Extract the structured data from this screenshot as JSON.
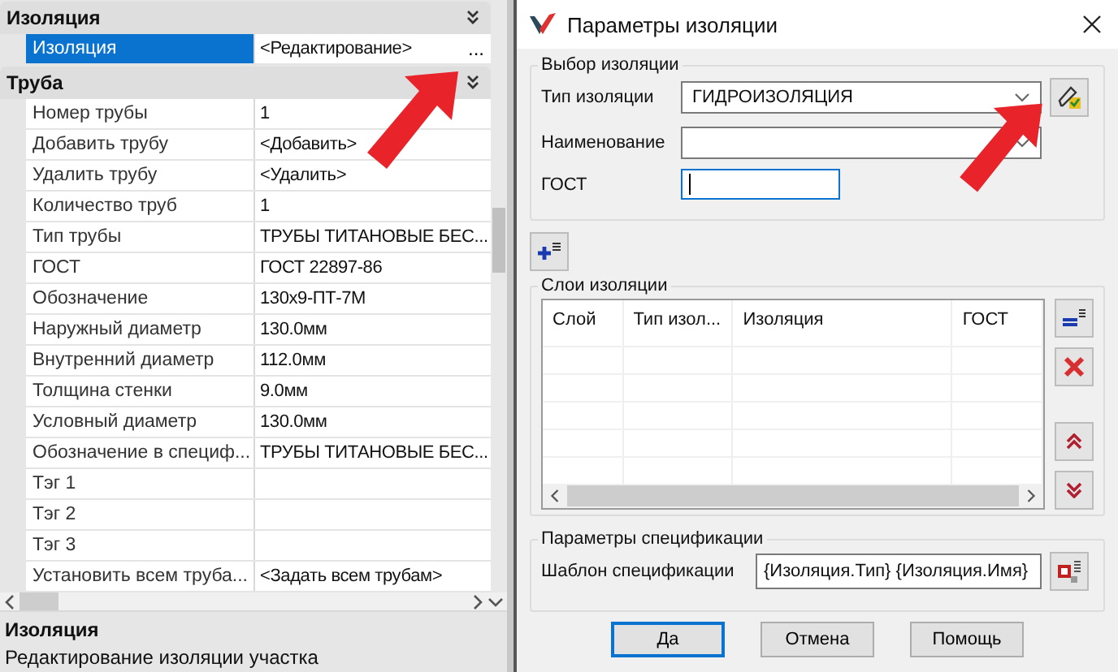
{
  "property_panel": {
    "categories": [
      {
        "title": "Изоляция",
        "expanded": true,
        "rows": [
          {
            "label": "Изоляция",
            "value": "<Редактирование>",
            "button": "...",
            "selected": true
          }
        ]
      },
      {
        "title": "Труба",
        "expanded": true,
        "rows": [
          {
            "label": "Номер трубы",
            "value": "1",
            "selected": false
          },
          {
            "label": "Добавить трубу",
            "value": "<Добавить>",
            "selected": false
          },
          {
            "label": "Удалить трубу",
            "value": "<Удалить>",
            "selected": false
          },
          {
            "label": "Количество труб",
            "value": "1",
            "selected": false
          },
          {
            "label": "Тип трубы",
            "value": "ТРУБЫ ТИТАНОВЫЕ БЕС...",
            "selected": false
          },
          {
            "label": "ГОСТ",
            "value": "ГОСТ 22897-86",
            "selected": false
          },
          {
            "label": "Обозначение",
            "value": "130x9-ПТ-7М",
            "selected": false
          },
          {
            "label": "Наружный диаметр",
            "value": "130.0мм",
            "selected": false
          },
          {
            "label": "Внутренний диаметр",
            "value": "112.0мм",
            "selected": false
          },
          {
            "label": "Толщина стенки",
            "value": "9.0мм",
            "selected": false
          },
          {
            "label": "Условный диаметр",
            "value": "130.0мм",
            "selected": false
          },
          {
            "label": "Обозначение в специф...",
            "value": "ТРУБЫ ТИТАНОВЫЕ БЕС...",
            "selected": false
          },
          {
            "label": "Тэг 1",
            "selected": false
          },
          {
            "label": "Тэг 2",
            "selected": false
          },
          {
            "label": "Тэг 3",
            "selected": false
          },
          {
            "label": "Установить всем труба...",
            "value": "<Задать всем трубам>",
            "selected": false
          }
        ]
      }
    ],
    "description": {
      "title": "Изоляция",
      "text": "Редактирование изоляции участка"
    }
  },
  "dialog": {
    "title": "Параметры изоляции",
    "selection_group": {
      "title": "Выбор изоляции",
      "fields": [
        {
          "kind": "combo",
          "label": "Тип изоляции",
          "value": "ГИДРОИЗОЛЯЦИЯ",
          "focused": false
        },
        {
          "kind": "combo",
          "label": "Наименование",
          "focused": false
        },
        {
          "kind": "text",
          "label": "ГОСТ",
          "focused": true
        }
      ]
    },
    "layers_group": {
      "title": "Слои изоляции",
      "columns": [
        "Слой",
        "Тип изол...",
        "Изоляция",
        "ГОСТ"
      ]
    },
    "spec_group": {
      "title": "Параметры спецификации",
      "label": "Шаблон спецификации",
      "value": "{Изоляция.Тип} {Изоляция.Имя}"
    },
    "buttons": [
      {
        "label": "Да",
        "default": true
      },
      {
        "label": "Отмена",
        "default": false
      },
      {
        "label": "Помощь",
        "default": false
      }
    ]
  }
}
